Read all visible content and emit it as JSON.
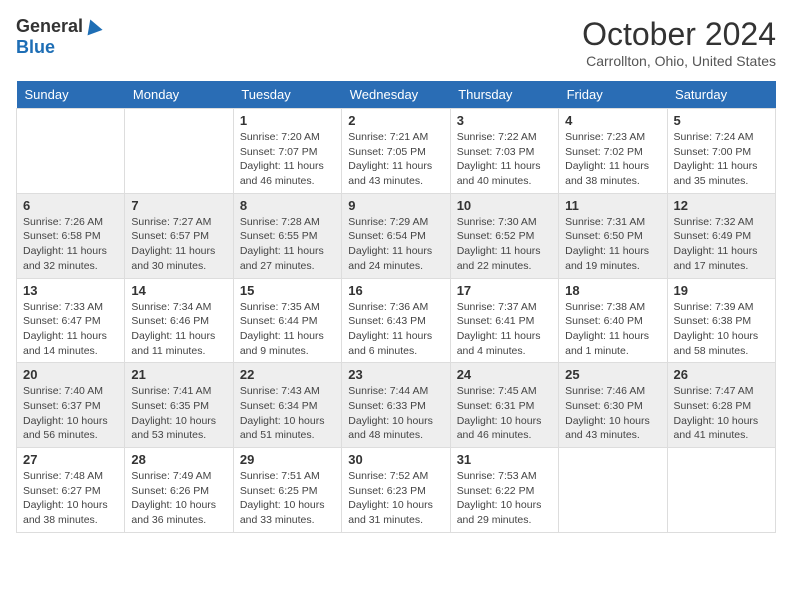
{
  "header": {
    "logo_general": "General",
    "logo_blue": "Blue",
    "month_title": "October 2024",
    "location": "Carrollton, Ohio, United States"
  },
  "weekdays": [
    "Sunday",
    "Monday",
    "Tuesday",
    "Wednesday",
    "Thursday",
    "Friday",
    "Saturday"
  ],
  "weeks": [
    [
      {
        "day": "",
        "info": ""
      },
      {
        "day": "",
        "info": ""
      },
      {
        "day": "1",
        "info": "Sunrise: 7:20 AM\nSunset: 7:07 PM\nDaylight: 11 hours and 46 minutes."
      },
      {
        "day": "2",
        "info": "Sunrise: 7:21 AM\nSunset: 7:05 PM\nDaylight: 11 hours and 43 minutes."
      },
      {
        "day": "3",
        "info": "Sunrise: 7:22 AM\nSunset: 7:03 PM\nDaylight: 11 hours and 40 minutes."
      },
      {
        "day": "4",
        "info": "Sunrise: 7:23 AM\nSunset: 7:02 PM\nDaylight: 11 hours and 38 minutes."
      },
      {
        "day": "5",
        "info": "Sunrise: 7:24 AM\nSunset: 7:00 PM\nDaylight: 11 hours and 35 minutes."
      }
    ],
    [
      {
        "day": "6",
        "info": "Sunrise: 7:26 AM\nSunset: 6:58 PM\nDaylight: 11 hours and 32 minutes."
      },
      {
        "day": "7",
        "info": "Sunrise: 7:27 AM\nSunset: 6:57 PM\nDaylight: 11 hours and 30 minutes."
      },
      {
        "day": "8",
        "info": "Sunrise: 7:28 AM\nSunset: 6:55 PM\nDaylight: 11 hours and 27 minutes."
      },
      {
        "day": "9",
        "info": "Sunrise: 7:29 AM\nSunset: 6:54 PM\nDaylight: 11 hours and 24 minutes."
      },
      {
        "day": "10",
        "info": "Sunrise: 7:30 AM\nSunset: 6:52 PM\nDaylight: 11 hours and 22 minutes."
      },
      {
        "day": "11",
        "info": "Sunrise: 7:31 AM\nSunset: 6:50 PM\nDaylight: 11 hours and 19 minutes."
      },
      {
        "day": "12",
        "info": "Sunrise: 7:32 AM\nSunset: 6:49 PM\nDaylight: 11 hours and 17 minutes."
      }
    ],
    [
      {
        "day": "13",
        "info": "Sunrise: 7:33 AM\nSunset: 6:47 PM\nDaylight: 11 hours and 14 minutes."
      },
      {
        "day": "14",
        "info": "Sunrise: 7:34 AM\nSunset: 6:46 PM\nDaylight: 11 hours and 11 minutes."
      },
      {
        "day": "15",
        "info": "Sunrise: 7:35 AM\nSunset: 6:44 PM\nDaylight: 11 hours and 9 minutes."
      },
      {
        "day": "16",
        "info": "Sunrise: 7:36 AM\nSunset: 6:43 PM\nDaylight: 11 hours and 6 minutes."
      },
      {
        "day": "17",
        "info": "Sunrise: 7:37 AM\nSunset: 6:41 PM\nDaylight: 11 hours and 4 minutes."
      },
      {
        "day": "18",
        "info": "Sunrise: 7:38 AM\nSunset: 6:40 PM\nDaylight: 11 hours and 1 minute."
      },
      {
        "day": "19",
        "info": "Sunrise: 7:39 AM\nSunset: 6:38 PM\nDaylight: 10 hours and 58 minutes."
      }
    ],
    [
      {
        "day": "20",
        "info": "Sunrise: 7:40 AM\nSunset: 6:37 PM\nDaylight: 10 hours and 56 minutes."
      },
      {
        "day": "21",
        "info": "Sunrise: 7:41 AM\nSunset: 6:35 PM\nDaylight: 10 hours and 53 minutes."
      },
      {
        "day": "22",
        "info": "Sunrise: 7:43 AM\nSunset: 6:34 PM\nDaylight: 10 hours and 51 minutes."
      },
      {
        "day": "23",
        "info": "Sunrise: 7:44 AM\nSunset: 6:33 PM\nDaylight: 10 hours and 48 minutes."
      },
      {
        "day": "24",
        "info": "Sunrise: 7:45 AM\nSunset: 6:31 PM\nDaylight: 10 hours and 46 minutes."
      },
      {
        "day": "25",
        "info": "Sunrise: 7:46 AM\nSunset: 6:30 PM\nDaylight: 10 hours and 43 minutes."
      },
      {
        "day": "26",
        "info": "Sunrise: 7:47 AM\nSunset: 6:28 PM\nDaylight: 10 hours and 41 minutes."
      }
    ],
    [
      {
        "day": "27",
        "info": "Sunrise: 7:48 AM\nSunset: 6:27 PM\nDaylight: 10 hours and 38 minutes."
      },
      {
        "day": "28",
        "info": "Sunrise: 7:49 AM\nSunset: 6:26 PM\nDaylight: 10 hours and 36 minutes."
      },
      {
        "day": "29",
        "info": "Sunrise: 7:51 AM\nSunset: 6:25 PM\nDaylight: 10 hours and 33 minutes."
      },
      {
        "day": "30",
        "info": "Sunrise: 7:52 AM\nSunset: 6:23 PM\nDaylight: 10 hours and 31 minutes."
      },
      {
        "day": "31",
        "info": "Sunrise: 7:53 AM\nSunset: 6:22 PM\nDaylight: 10 hours and 29 minutes."
      },
      {
        "day": "",
        "info": ""
      },
      {
        "day": "",
        "info": ""
      }
    ]
  ]
}
